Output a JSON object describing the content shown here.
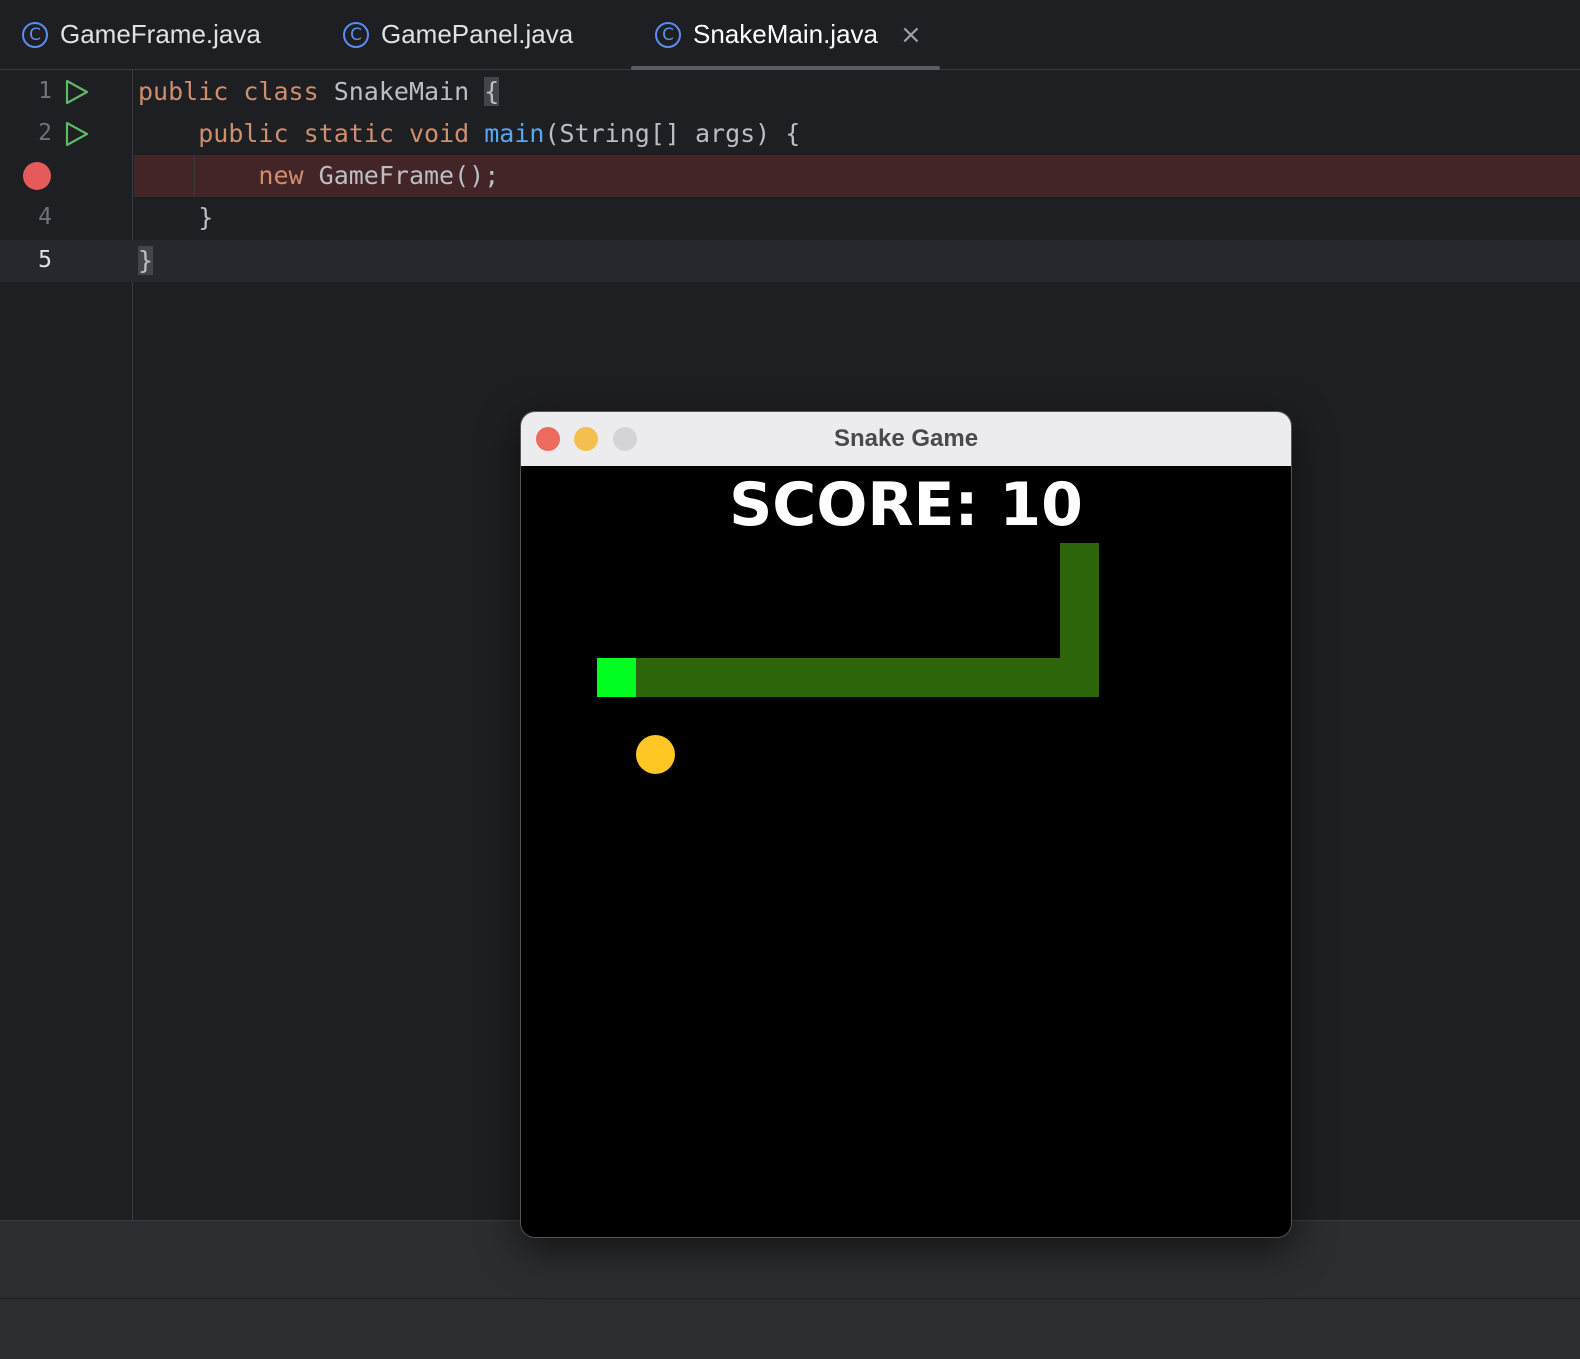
{
  "tabs": [
    {
      "label": "GameFrame.java",
      "icon": "class-icon",
      "active": false
    },
    {
      "label": "GamePanel.java",
      "icon": "class-icon",
      "active": false
    },
    {
      "label": "SnakeMain.java",
      "icon": "class-icon",
      "active": true,
      "close": "×"
    }
  ],
  "editor": {
    "line_numbers": [
      "1",
      "2",
      "",
      "4",
      "5"
    ],
    "code": {
      "l1_kw1": "public",
      "l1_kw2": "class",
      "l1_name": "SnakeMain",
      "l1_brace": "{",
      "l2_kw1": "public",
      "l2_kw2": "static",
      "l2_kw3": "void",
      "l2_fn": "main",
      "l2_rest": "(String[] args) {",
      "l3_kw": "new",
      "l3_rest": "GameFrame();",
      "l4": "}",
      "l5": "}"
    }
  },
  "game_window": {
    "title": "Snake Game",
    "score_text": "SCORE: 10",
    "colors": {
      "background": "#000000",
      "snake_head": "#00ff21",
      "snake_body": "#2d660a",
      "food": "#ffc624",
      "score_text": "#ffffff"
    }
  }
}
